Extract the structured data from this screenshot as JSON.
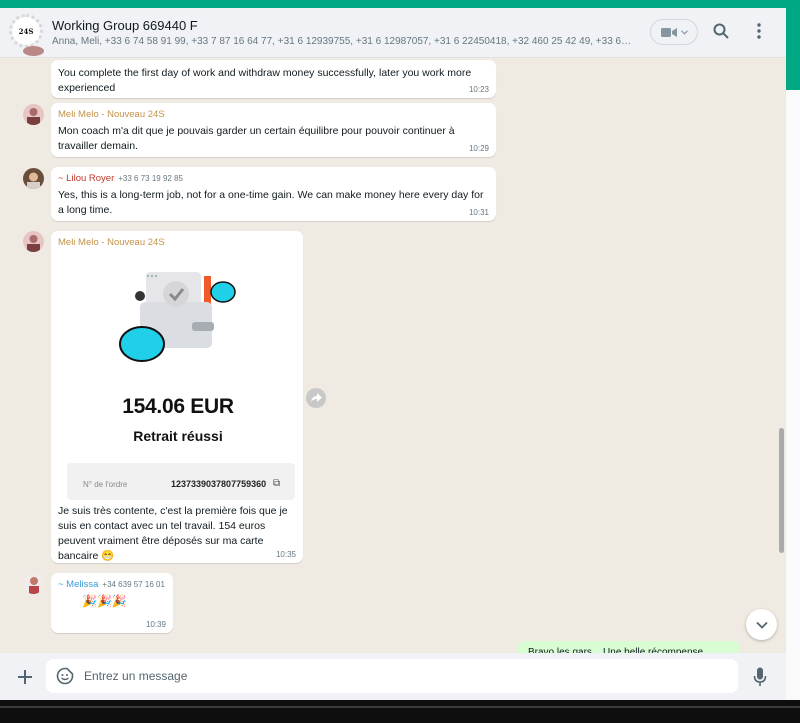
{
  "header": {
    "title": "Working Group 669440 F",
    "avatar_text": "24S",
    "members": "Anna, Meli, +33 6 74 58 91 99, +33 7 87 16 64 77, +31 6 12939755, +31 6 12987057, +31 6 22450418, +32 460 25 42 49, +33 6 32 02..."
  },
  "messages": [
    {
      "text": "You complete the first day of work and withdraw money successfully, later you work more experienced",
      "time": "10:23"
    },
    {
      "sender": "Meli Melo - Nouveau 24S",
      "sender_color": "#c4914a",
      "text": "Mon coach m'a dit que je pouvais garder un certain équilibre pour pouvoir continuer à travailler demain.",
      "time": "10:29"
    },
    {
      "sender": "~ Lilou Royer",
      "sender_color": "#c0392b",
      "phone": "+33 6 73 19 92 85",
      "text": "Yes, this is a long-term job, not for a one-time gain. We can make money here every day for a long time.",
      "time": "10:31"
    },
    {
      "sender": "Meli Melo - Nouveau 24S",
      "sender_color": "#c4914a",
      "receipt": {
        "amount": "154.06 EUR",
        "status": "Retrait réussi",
        "order_label": "N° de l'ordre",
        "order_number": "1237339037807759360"
      },
      "text": "Je suis très contente, c'est la première fois que je suis en contact avec un tel travail. 154 euros peuvent vraiment être déposés sur ma carte bancaire 😁",
      "time": "10:35"
    },
    {
      "sender": "~ Melissa",
      "sender_color": "#3a9bd4",
      "phone": "+34 639 57 16 01",
      "text": "🎉🎉🎉",
      "time": "10:39"
    }
  ],
  "own_preview": "Bravo les gars... Une belle récompense",
  "composer": {
    "placeholder": "Entrez un message"
  },
  "colors": {
    "accent": "#00a884",
    "chat_bg": "#efeae2",
    "own_bubble": "#d9fdd3"
  }
}
